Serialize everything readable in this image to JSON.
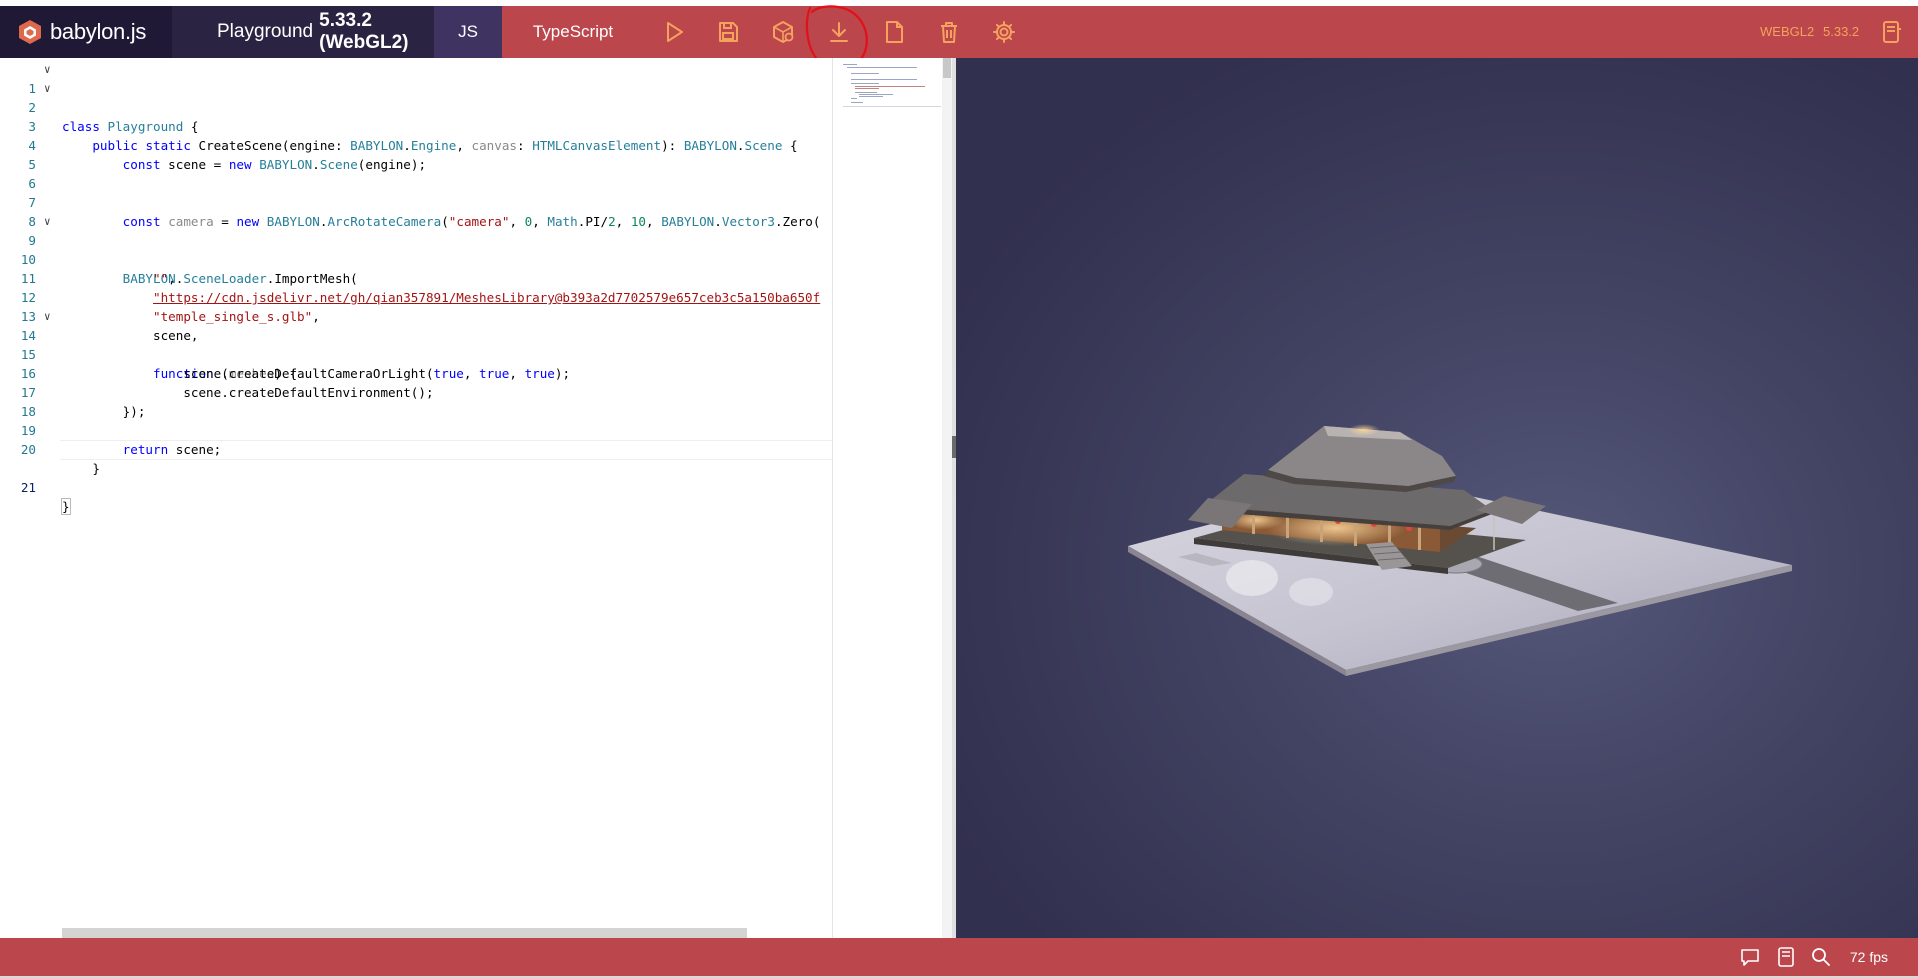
{
  "topbar": {
    "brand": "babylon.js",
    "title_prefix": "Playground",
    "title_version": "5.33.2 (WebGL2)",
    "tab_js": "JS",
    "tab_ts": "TypeScript",
    "engine_label": "WEBGL2",
    "version_label": "5.33.2",
    "icons": [
      "run-icon",
      "save-icon",
      "inspector-icon",
      "download-icon",
      "new-icon",
      "clear-icon",
      "settings-icon",
      "examples-icon"
    ],
    "accent_color": "#bb464b",
    "dark_color": "#201936",
    "icon_color": "#f4a25e"
  },
  "editor": {
    "lines": [
      {
        "n": "1",
        "code": "class Playground {"
      },
      {
        "n": "2",
        "code": "    public static CreateScene(engine: BABYLON.Engine, canvas: HTMLCanvasElement): BABYLON.Scene {"
      },
      {
        "n": "3",
        "code": ""
      },
      {
        "n": "4",
        "code": "        const scene = new BABYLON.Scene(engine);"
      },
      {
        "n": "5",
        "code": ""
      },
      {
        "n": "6",
        "code": ""
      },
      {
        "n": "7",
        "code": "        const camera = new BABYLON.ArcRotateCamera(\"camera\", 0, Math.PI/2, 10, BABYLON.Vector3.Zero("
      },
      {
        "n": "8",
        "code": ""
      },
      {
        "n": "9",
        "code": "        BABYLON.SceneLoader.ImportMesh("
      },
      {
        "n": "10",
        "code": "            \"\","
      },
      {
        "n": "11",
        "code": "            \"https://cdn.jsdelivr.net/gh/qian357891/MeshesLibrary@b393a2d7702579e657ceb3c5a150ba650f"
      },
      {
        "n": "12",
        "code": "            \"temple_single_s.glb\","
      },
      {
        "n": "13",
        "code": "            scene,"
      },
      {
        "n": "14",
        "code": "            function (meshes) {"
      },
      {
        "n": "15",
        "code": "                scene.createDefaultCameraOrLight(true, true, true);"
      },
      {
        "n": "16",
        "code": "                scene.createDefaultEnvironment();"
      },
      {
        "n": "17",
        "code": "        });"
      },
      {
        "n": "18",
        "code": ""
      },
      {
        "n": "19",
        "code": "        return scene;"
      },
      {
        "n": "20",
        "code": "    }"
      },
      {
        "n": "21",
        "code": "}"
      }
    ]
  },
  "status": {
    "fps": "72 fps",
    "icons": [
      "feedback-icon",
      "docs-icon",
      "search-icon"
    ]
  }
}
